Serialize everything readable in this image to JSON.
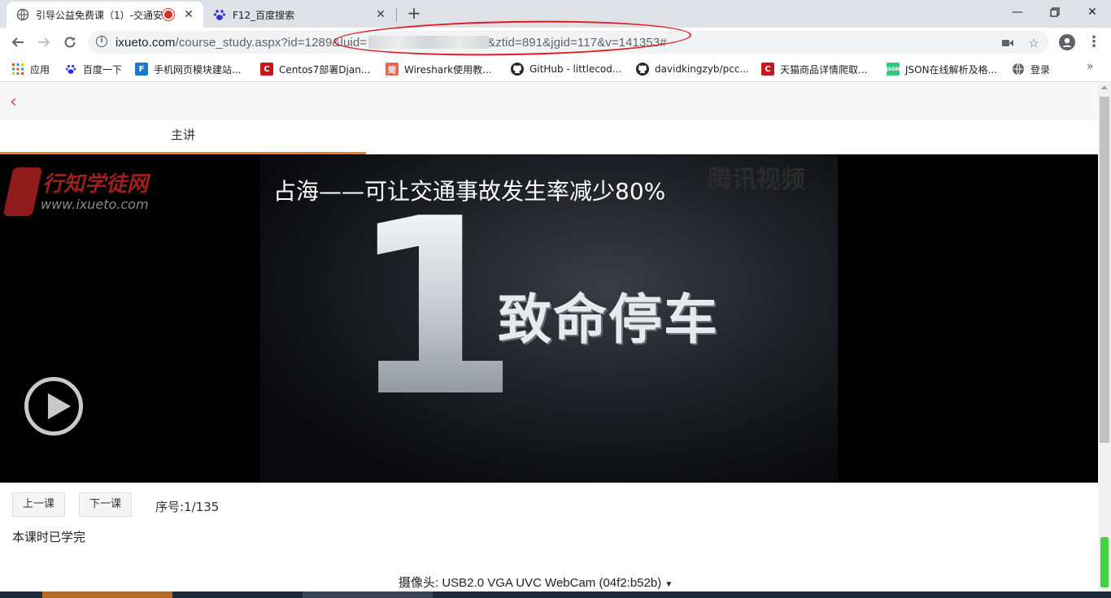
{
  "browser": {
    "tabs": [
      {
        "title": "引导公益免费课（1）-交通安"
      },
      {
        "title": "F12_百度搜索"
      }
    ],
    "url_host": "ixueto.com",
    "url_path_1": "/course_study.aspx?id=1289&luid=",
    "url_path_2": "&ztid=891&jgid=117&v=141353#"
  },
  "bookmarks": [
    {
      "label": "应用",
      "icon": "apps-grid-icon"
    },
    {
      "label": "百度一下",
      "icon": "baidu-paw-icon"
    },
    {
      "label": "手机网页模块建站...",
      "icon": "site-builder-icon"
    },
    {
      "label": "Centos7部署Djan...",
      "icon": "csdn-c-icon"
    },
    {
      "label": "Wireshark使用教...",
      "icon": "jianshu-icon"
    },
    {
      "label": "GitHub - littlecod...",
      "icon": "github-icon"
    },
    {
      "label": "davidkingzyb/pcc...",
      "icon": "github-icon"
    },
    {
      "label": "天猫商品详情爬取...",
      "icon": "csdn-c-icon"
    },
    {
      "label": "JSON在线解析及格...",
      "icon": "json-icon"
    },
    {
      "label": "登录",
      "icon": "globe-icon"
    }
  ],
  "page": {
    "tab_label": "主讲",
    "video": {
      "subtitle": "占海——可让交通事故发生率减少80%",
      "big_number": "1",
      "caption": "致命停车",
      "ghost_text": "腾讯视频",
      "logo_text": "行知学徒网",
      "logo_url": "www.ixueto.com"
    },
    "prev_label": "上一课",
    "next_label": "下一课",
    "sequence": "序号:1/135",
    "status": "本课时已学完",
    "camera_label": "摄像头:",
    "camera_value": "USB2.0 VGA UVC WebCam (04f2:b52b)"
  }
}
